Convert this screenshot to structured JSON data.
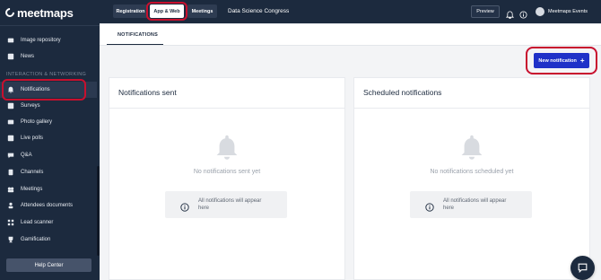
{
  "brand": {
    "name": "meetmaps"
  },
  "topbar": {
    "tabs": [
      {
        "label": "Registration"
      },
      {
        "label": "App & Web"
      },
      {
        "label": "Meetings"
      }
    ],
    "event_title": "Data Science Congress",
    "preview_label": "Preview",
    "account_name": "Meetmaps Events"
  },
  "sidebar": {
    "items_top": [
      {
        "label": "Image repository",
        "icon": "image-repository-icon"
      },
      {
        "label": "News",
        "icon": "news-icon"
      }
    ],
    "section_label": "INTERACTION & NETWORKING",
    "items": [
      {
        "label": "Notifications",
        "icon": "bell-icon"
      },
      {
        "label": "Surveys",
        "icon": "survey-icon"
      },
      {
        "label": "Photo gallery",
        "icon": "photo-icon"
      },
      {
        "label": "Live polls",
        "icon": "poll-icon"
      },
      {
        "label": "Q&A",
        "icon": "qa-icon"
      },
      {
        "label": "Channels",
        "icon": "channels-icon"
      },
      {
        "label": "Meetings",
        "icon": "meetings-icon"
      },
      {
        "label": "Attendees documents",
        "icon": "documents-icon"
      },
      {
        "label": "Lead scanner",
        "icon": "scanner-icon"
      },
      {
        "label": "Gamification",
        "icon": "trophy-icon"
      }
    ],
    "help_label": "Help Center"
  },
  "content": {
    "tab_label": "NOTIFICATIONS",
    "new_button_label": "New notification",
    "sent": {
      "title": "Notifications sent",
      "empty_text": "No notifications sent yet",
      "info_text": "All notifications will appear here"
    },
    "scheduled": {
      "title": "Scheduled notifications",
      "empty_text": "No notifications scheduled yet",
      "info_text": "All notifications will appear here"
    }
  },
  "colors": {
    "sidebar_bg": "#1c2a3e",
    "primary_button": "#1f31c8",
    "highlight": "#c8102e"
  }
}
